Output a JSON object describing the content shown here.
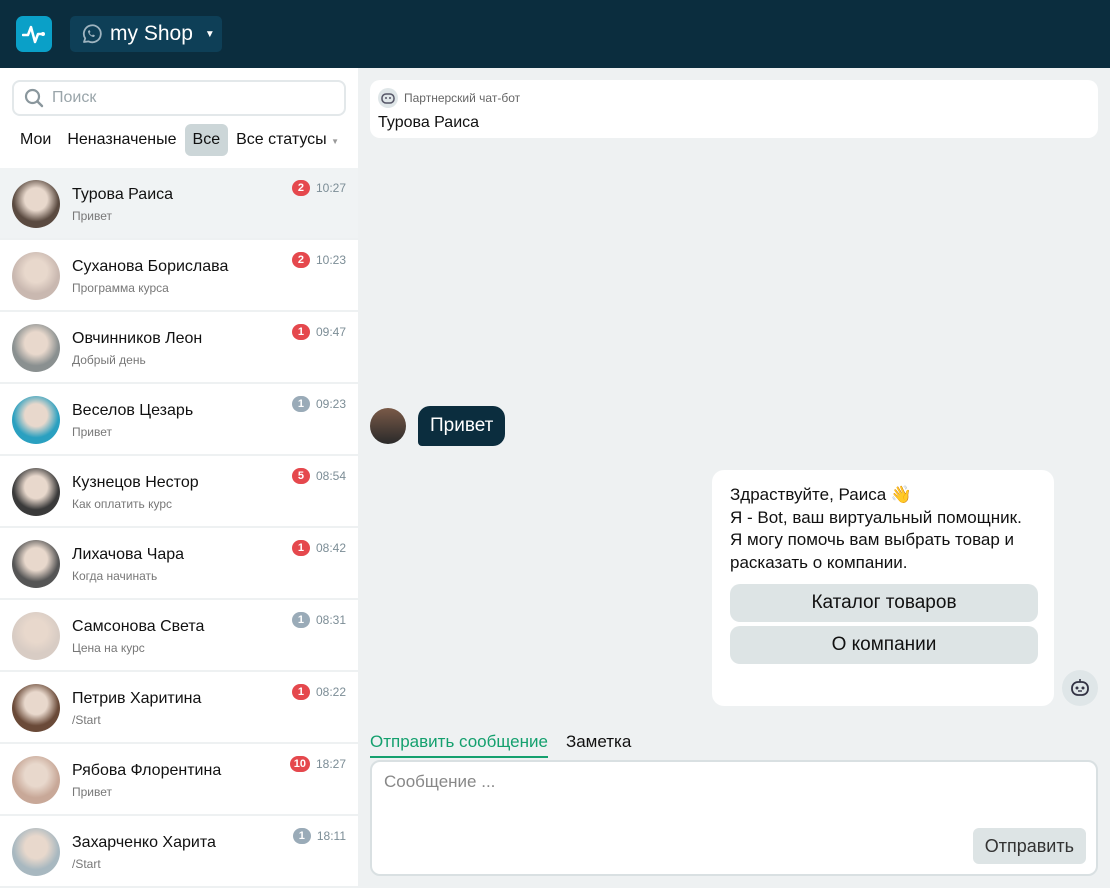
{
  "header": {
    "shop_name": "my Shop"
  },
  "sidebar": {
    "search_placeholder": "Поиск",
    "filters": [
      "Мои",
      "Неназначеные",
      "Все",
      "Все статусы"
    ],
    "chats": [
      {
        "name": "Турова Раиса",
        "preview": "Привет",
        "time": "10:27",
        "unread": "2",
        "badge_color": "#e5484d",
        "avatar": "#5a4a40"
      },
      {
        "name": "Суханова Борислава",
        "preview": "Программа курса",
        "time": "10:23",
        "unread": "2",
        "badge_color": "#e5484d",
        "avatar": "#c9b8b0"
      },
      {
        "name": "Овчинников Леон",
        "preview": "Добрый день",
        "time": "09:47",
        "unread": "1",
        "badge_color": "#e5484d",
        "avatar": "#8a9090"
      },
      {
        "name": "Веселов Цезарь",
        "preview": "Привет",
        "time": "09:23",
        "unread": "1",
        "badge_color": "#9aabb8",
        "avatar": "#2aa0c0"
      },
      {
        "name": "Кузнецов Нестор",
        "preview": "Как оплатить курс",
        "time": "08:54",
        "unread": "5",
        "badge_color": "#e5484d",
        "avatar": "#3a3a3a"
      },
      {
        "name": "Лихачова Чара",
        "preview": "Когда начинать",
        "time": "08:42",
        "unread": "1",
        "badge_color": "#e5484d",
        "avatar": "#555"
      },
      {
        "name": "Самсонова Света",
        "preview": "Цена на курс",
        "time": "08:31",
        "unread": "1",
        "badge_color": "#9aabb8",
        "avatar": "#d8ccc4"
      },
      {
        "name": "Петрив Харитина",
        "preview": "/Start",
        "time": "08:22",
        "unread": "1",
        "badge_color": "#e5484d",
        "avatar": "#6a4a38"
      },
      {
        "name": "Рябова Флорентина",
        "preview": "Привет",
        "time": "18:27",
        "unread": "10",
        "badge_color": "#e5484d",
        "avatar": "#c8a898"
      },
      {
        "name": "Захарченко Харита",
        "preview": "/Start",
        "time": "18:11",
        "unread": "1",
        "badge_color": "#9aabb8",
        "avatar": "#a8b8c0"
      }
    ]
  },
  "chat": {
    "source": "Партнерский чат-бот",
    "contact": "Турова Раиса",
    "incoming": "Привет",
    "bot_lines": [
      "Здраствуйте, Раиса 👋",
      "Я - Bot, ваш виртуальный помощник.",
      "Я могу помочь вам выбрать товар и расказать о компании."
    ],
    "quick_replies": [
      "Каталог товаров",
      "О компании"
    ],
    "tabs": [
      "Отправить сообщение",
      "Заметка"
    ],
    "input_placeholder": "Сообщение ...",
    "send_label": "Отправить"
  }
}
